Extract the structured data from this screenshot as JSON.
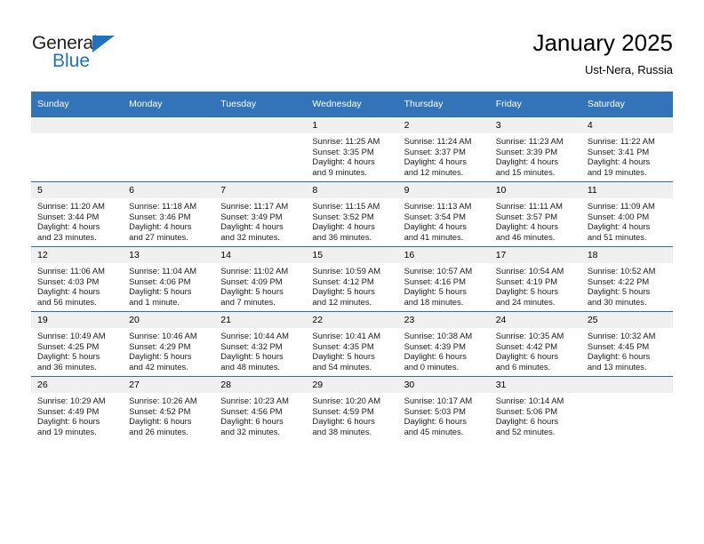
{
  "brand": {
    "name_part1": "General",
    "name_part2": "Blue",
    "accent_color": "#1f72bd"
  },
  "header": {
    "title": "January 2025",
    "subtitle": "Ust-Nera, Russia"
  },
  "calendar": {
    "header_bg": "#3374b8",
    "daynum_bg": "#f0f0f0",
    "weekday_headers": [
      "Sunday",
      "Monday",
      "Tuesday",
      "Wednesday",
      "Thursday",
      "Friday",
      "Saturday"
    ],
    "weeks": [
      [
        {
          "day": "",
          "sunrise": "",
          "sunset": "",
          "daylight_line1": "",
          "daylight_line2": ""
        },
        {
          "day": "",
          "sunrise": "",
          "sunset": "",
          "daylight_line1": "",
          "daylight_line2": ""
        },
        {
          "day": "",
          "sunrise": "",
          "sunset": "",
          "daylight_line1": "",
          "daylight_line2": ""
        },
        {
          "day": "1",
          "sunrise": "Sunrise: 11:25 AM",
          "sunset": "Sunset: 3:35 PM",
          "daylight_line1": "Daylight: 4 hours",
          "daylight_line2": "and 9 minutes."
        },
        {
          "day": "2",
          "sunrise": "Sunrise: 11:24 AM",
          "sunset": "Sunset: 3:37 PM",
          "daylight_line1": "Daylight: 4 hours",
          "daylight_line2": "and 12 minutes."
        },
        {
          "day": "3",
          "sunrise": "Sunrise: 11:23 AM",
          "sunset": "Sunset: 3:39 PM",
          "daylight_line1": "Daylight: 4 hours",
          "daylight_line2": "and 15 minutes."
        },
        {
          "day": "4",
          "sunrise": "Sunrise: 11:22 AM",
          "sunset": "Sunset: 3:41 PM",
          "daylight_line1": "Daylight: 4 hours",
          "daylight_line2": "and 19 minutes."
        }
      ],
      [
        {
          "day": "5",
          "sunrise": "Sunrise: 11:20 AM",
          "sunset": "Sunset: 3:44 PM",
          "daylight_line1": "Daylight: 4 hours",
          "daylight_line2": "and 23 minutes."
        },
        {
          "day": "6",
          "sunrise": "Sunrise: 11:18 AM",
          "sunset": "Sunset: 3:46 PM",
          "daylight_line1": "Daylight: 4 hours",
          "daylight_line2": "and 27 minutes."
        },
        {
          "day": "7",
          "sunrise": "Sunrise: 11:17 AM",
          "sunset": "Sunset: 3:49 PM",
          "daylight_line1": "Daylight: 4 hours",
          "daylight_line2": "and 32 minutes."
        },
        {
          "day": "8",
          "sunrise": "Sunrise: 11:15 AM",
          "sunset": "Sunset: 3:52 PM",
          "daylight_line1": "Daylight: 4 hours",
          "daylight_line2": "and 36 minutes."
        },
        {
          "day": "9",
          "sunrise": "Sunrise: 11:13 AM",
          "sunset": "Sunset: 3:54 PM",
          "daylight_line1": "Daylight: 4 hours",
          "daylight_line2": "and 41 minutes."
        },
        {
          "day": "10",
          "sunrise": "Sunrise: 11:11 AM",
          "sunset": "Sunset: 3:57 PM",
          "daylight_line1": "Daylight: 4 hours",
          "daylight_line2": "and 46 minutes."
        },
        {
          "day": "11",
          "sunrise": "Sunrise: 11:09 AM",
          "sunset": "Sunset: 4:00 PM",
          "daylight_line1": "Daylight: 4 hours",
          "daylight_line2": "and 51 minutes."
        }
      ],
      [
        {
          "day": "12",
          "sunrise": "Sunrise: 11:06 AM",
          "sunset": "Sunset: 4:03 PM",
          "daylight_line1": "Daylight: 4 hours",
          "daylight_line2": "and 56 minutes."
        },
        {
          "day": "13",
          "sunrise": "Sunrise: 11:04 AM",
          "sunset": "Sunset: 4:06 PM",
          "daylight_line1": "Daylight: 5 hours",
          "daylight_line2": "and 1 minute."
        },
        {
          "day": "14",
          "sunrise": "Sunrise: 11:02 AM",
          "sunset": "Sunset: 4:09 PM",
          "daylight_line1": "Daylight: 5 hours",
          "daylight_line2": "and 7 minutes."
        },
        {
          "day": "15",
          "sunrise": "Sunrise: 10:59 AM",
          "sunset": "Sunset: 4:12 PM",
          "daylight_line1": "Daylight: 5 hours",
          "daylight_line2": "and 12 minutes."
        },
        {
          "day": "16",
          "sunrise": "Sunrise: 10:57 AM",
          "sunset": "Sunset: 4:16 PM",
          "daylight_line1": "Daylight: 5 hours",
          "daylight_line2": "and 18 minutes."
        },
        {
          "day": "17",
          "sunrise": "Sunrise: 10:54 AM",
          "sunset": "Sunset: 4:19 PM",
          "daylight_line1": "Daylight: 5 hours",
          "daylight_line2": "and 24 minutes."
        },
        {
          "day": "18",
          "sunrise": "Sunrise: 10:52 AM",
          "sunset": "Sunset: 4:22 PM",
          "daylight_line1": "Daylight: 5 hours",
          "daylight_line2": "and 30 minutes."
        }
      ],
      [
        {
          "day": "19",
          "sunrise": "Sunrise: 10:49 AM",
          "sunset": "Sunset: 4:25 PM",
          "daylight_line1": "Daylight: 5 hours",
          "daylight_line2": "and 36 minutes."
        },
        {
          "day": "20",
          "sunrise": "Sunrise: 10:46 AM",
          "sunset": "Sunset: 4:29 PM",
          "daylight_line1": "Daylight: 5 hours",
          "daylight_line2": "and 42 minutes."
        },
        {
          "day": "21",
          "sunrise": "Sunrise: 10:44 AM",
          "sunset": "Sunset: 4:32 PM",
          "daylight_line1": "Daylight: 5 hours",
          "daylight_line2": "and 48 minutes."
        },
        {
          "day": "22",
          "sunrise": "Sunrise: 10:41 AM",
          "sunset": "Sunset: 4:35 PM",
          "daylight_line1": "Daylight: 5 hours",
          "daylight_line2": "and 54 minutes."
        },
        {
          "day": "23",
          "sunrise": "Sunrise: 10:38 AM",
          "sunset": "Sunset: 4:39 PM",
          "daylight_line1": "Daylight: 6 hours",
          "daylight_line2": "and 0 minutes."
        },
        {
          "day": "24",
          "sunrise": "Sunrise: 10:35 AM",
          "sunset": "Sunset: 4:42 PM",
          "daylight_line1": "Daylight: 6 hours",
          "daylight_line2": "and 6 minutes."
        },
        {
          "day": "25",
          "sunrise": "Sunrise: 10:32 AM",
          "sunset": "Sunset: 4:45 PM",
          "daylight_line1": "Daylight: 6 hours",
          "daylight_line2": "and 13 minutes."
        }
      ],
      [
        {
          "day": "26",
          "sunrise": "Sunrise: 10:29 AM",
          "sunset": "Sunset: 4:49 PM",
          "daylight_line1": "Daylight: 6 hours",
          "daylight_line2": "and 19 minutes."
        },
        {
          "day": "27",
          "sunrise": "Sunrise: 10:26 AM",
          "sunset": "Sunset: 4:52 PM",
          "daylight_line1": "Daylight: 6 hours",
          "daylight_line2": "and 26 minutes."
        },
        {
          "day": "28",
          "sunrise": "Sunrise: 10:23 AM",
          "sunset": "Sunset: 4:56 PM",
          "daylight_line1": "Daylight: 6 hours",
          "daylight_line2": "and 32 minutes."
        },
        {
          "day": "29",
          "sunrise": "Sunrise: 10:20 AM",
          "sunset": "Sunset: 4:59 PM",
          "daylight_line1": "Daylight: 6 hours",
          "daylight_line2": "and 38 minutes."
        },
        {
          "day": "30",
          "sunrise": "Sunrise: 10:17 AM",
          "sunset": "Sunset: 5:03 PM",
          "daylight_line1": "Daylight: 6 hours",
          "daylight_line2": "and 45 minutes."
        },
        {
          "day": "31",
          "sunrise": "Sunrise: 10:14 AM",
          "sunset": "Sunset: 5:06 PM",
          "daylight_line1": "Daylight: 6 hours",
          "daylight_line2": "and 52 minutes."
        },
        {
          "day": "",
          "sunrise": "",
          "sunset": "",
          "daylight_line1": "",
          "daylight_line2": ""
        }
      ]
    ]
  }
}
